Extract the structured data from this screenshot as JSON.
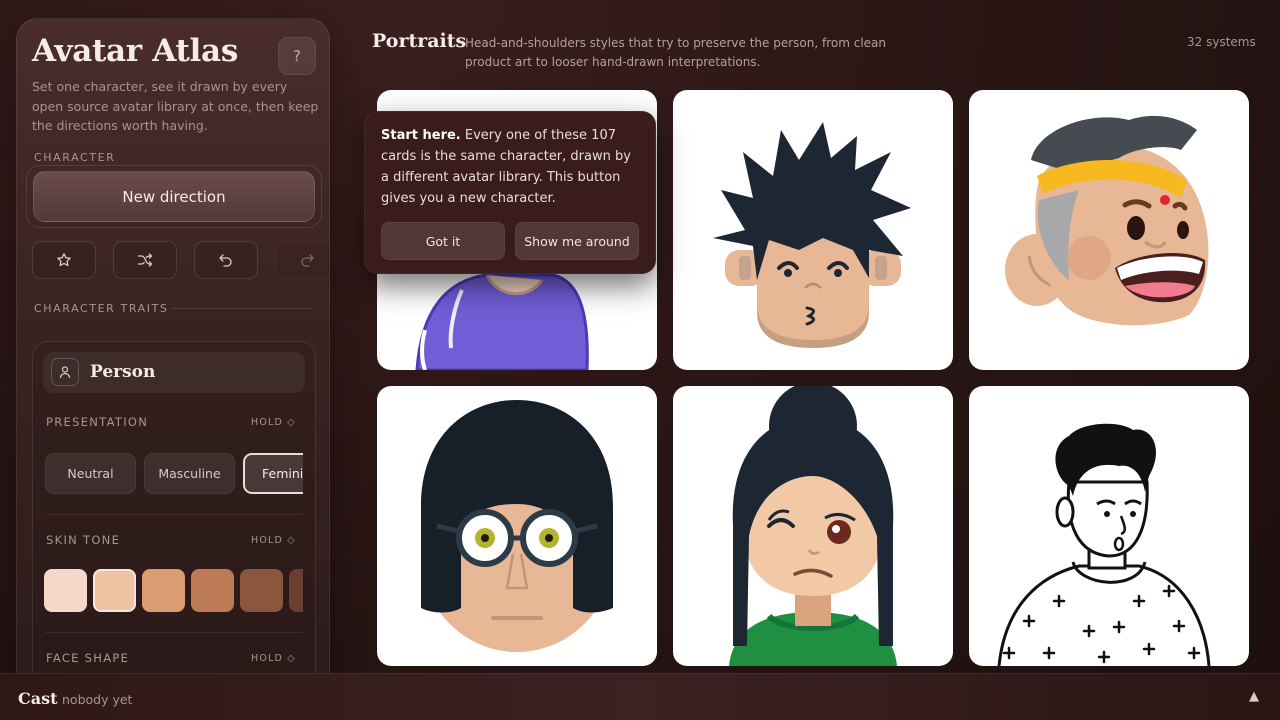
{
  "sidebar": {
    "title": "Avatar Atlas",
    "help_label": "?",
    "description": "Set one character, see it drawn by every open source avatar library at once, then keep the directions worth having.",
    "character_section": "CHARACTER",
    "new_direction_label": "New direction",
    "traits_section": "CHARACTER TRAITS",
    "person_label": "Person",
    "presentation": {
      "label": "PRESENTATION",
      "hold": "HOLD ◇",
      "options": [
        "Neutral",
        "Masculine",
        "Feminine"
      ],
      "selected": "Feminine"
    },
    "skin_tone": {
      "label": "SKIN TONE",
      "hold": "HOLD ◇",
      "colors": [
        "#f6d8c9",
        "#eec4a2",
        "#d99d71",
        "#bd7b55",
        "#8a573e",
        "#6b4030"
      ],
      "selected_index": 1
    },
    "face_shape": {
      "label": "FACE SHAPE",
      "hold": "HOLD ◇"
    }
  },
  "main": {
    "title": "Portraits",
    "description": "Head-and-shoulders styles that try to preserve the person, from clean product art to looser hand-drawn interpretations.",
    "count": "32 systems"
  },
  "tooltip": {
    "lead": "Start here.",
    "body": " Every one of these 107 cards is the same character, drawn by a different avatar library. This button gives you a new character.",
    "got_it": "Got it",
    "show_around": "Show me around"
  },
  "bottom": {
    "cast_label": "Cast",
    "cast_value": "nobody yet",
    "toggle": "▲"
  },
  "colors": {
    "accent": "#3a1d1b",
    "card_bg": "#ffffff"
  }
}
